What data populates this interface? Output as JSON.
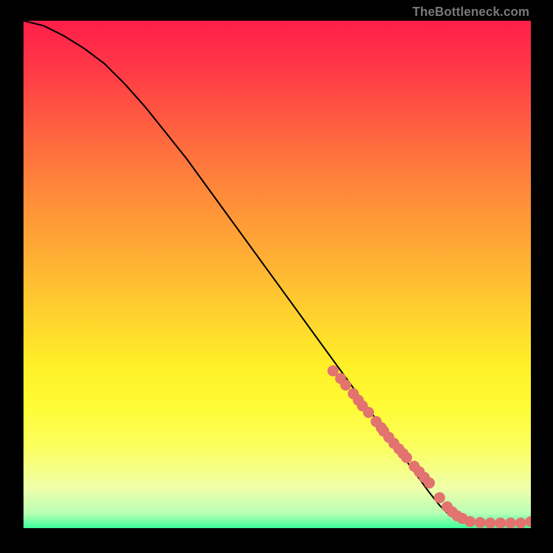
{
  "watermark": "TheBottleneck.com",
  "colors": {
    "point": "#e2736f",
    "curve": "#000000"
  },
  "chart_data": {
    "type": "line",
    "title": "",
    "xlabel": "",
    "ylabel": "",
    "xlim": [
      0,
      100
    ],
    "ylim": [
      0,
      100
    ],
    "curve": {
      "name": "bottleneck-curve",
      "x": [
        0,
        4,
        8,
        12,
        16,
        20,
        24,
        28,
        32,
        36,
        40,
        44,
        48,
        52,
        56,
        60,
        64,
        68,
        72,
        76,
        80,
        82,
        84,
        88,
        92,
        96,
        100
      ],
      "y": [
        100,
        99,
        97,
        94.5,
        91.5,
        87.5,
        83,
        78,
        73,
        67.5,
        62,
        56.5,
        51,
        45.5,
        40,
        34.5,
        29,
        23.5,
        18,
        12.5,
        7,
        4.5,
        2.5,
        1.2,
        1.0,
        1.0,
        1.3
      ]
    },
    "points": {
      "name": "data-points",
      "x": [
        61,
        62.5,
        63.5,
        65,
        66,
        66.8,
        68,
        69.5,
        70.5,
        71,
        72,
        73,
        74,
        74.8,
        75.5,
        77,
        78,
        79,
        80,
        82,
        83.5,
        84.5,
        85.5,
        86.5,
        88,
        90,
        92,
        94,
        96,
        98,
        100
      ],
      "y": [
        31,
        29.5,
        28.2,
        26.5,
        25.2,
        24.1,
        22.8,
        21,
        19.8,
        19.1,
        17.9,
        16.7,
        15.6,
        14.7,
        13.9,
        12.2,
        11.1,
        10,
        8.9,
        6,
        4.2,
        3.2,
        2.4,
        1.9,
        1.3,
        1.1,
        1.0,
        1.0,
        1.0,
        1.0,
        1.3
      ]
    }
  }
}
